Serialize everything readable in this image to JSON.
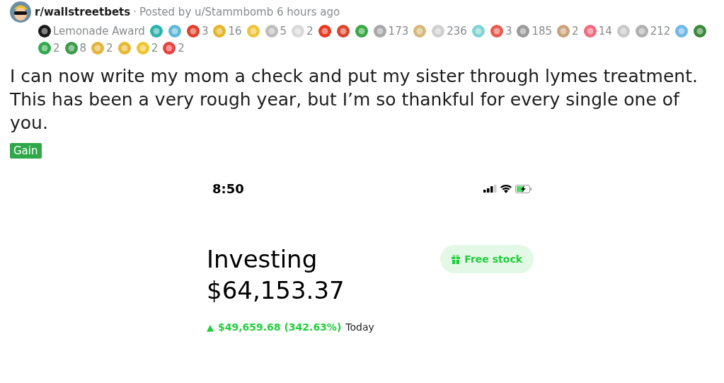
{
  "post": {
    "subreddit": "r/wallstreetbets",
    "separator": "·",
    "posted_by": "Posted by u/Stammbomb 6 hours ago",
    "awards": [
      {
        "color": "#1a1a1a",
        "label": "Lemonade Award"
      },
      {
        "color": "#2bb3a8"
      },
      {
        "color": "#5fb8d6"
      },
      {
        "color": "#e0412a",
        "count": "3"
      },
      {
        "color": "#e5b52a",
        "count": "16"
      },
      {
        "color": "#f0c43a"
      },
      {
        "color": "#bdbdbd",
        "count": "5"
      },
      {
        "color": "#d9d9d9",
        "count": "2"
      },
      {
        "color": "#e8391d"
      },
      {
        "color": "#d9452b"
      },
      {
        "color": "#3aa843"
      },
      {
        "color": "#a8a8a8",
        "count": "173"
      },
      {
        "color": "#d9b77a"
      },
      {
        "color": "#cfcfcf",
        "count": "236"
      },
      {
        "color": "#7fd3d6"
      },
      {
        "color": "#e85a4f",
        "count": "3"
      },
      {
        "color": "#9a9a9a",
        "count": "185"
      },
      {
        "color": "#c9a27a",
        "count": "2"
      },
      {
        "color": "#f06b7e",
        "count": "14"
      },
      {
        "color": "#c9c9c9"
      },
      {
        "color": "#b0b0b0",
        "count": "212"
      },
      {
        "color": "#6fb7e8"
      },
      {
        "color": "#3b8a3b"
      },
      {
        "color": "#2fa84a",
        "count": "2"
      },
      {
        "color": "#3b9a4a",
        "count": "8"
      },
      {
        "color": "#e2b43a",
        "count": "2"
      },
      {
        "color": "#e6b830"
      },
      {
        "color": "#f0c42e",
        "count": "2"
      },
      {
        "color": "#e8423f",
        "count": "2"
      }
    ],
    "title": "I can now write my mom a check and put my sister through lymes treatment. This has been a very rough year, but I’m so thankful for every single one of you.",
    "flair": "Gain"
  },
  "screenshot": {
    "time": "8:50",
    "heading": "Investing",
    "balance": "$64,153.37",
    "free_stock_button": "Free stock",
    "change_arrow": "▲",
    "change": "$49,659.68 (342.63%)",
    "period": "Today"
  }
}
